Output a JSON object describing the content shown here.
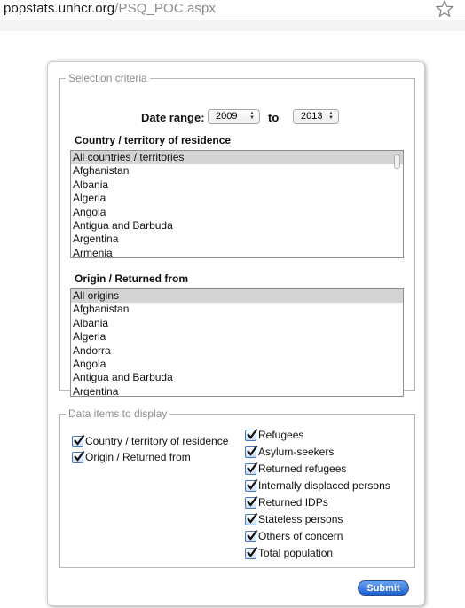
{
  "browser": {
    "url_host": "popstats.unhcr.org",
    "url_path": "/PSQ_POC.aspx"
  },
  "selection": {
    "legend": "Selection criteria",
    "date_range_label": "Date range:",
    "from_value": "2009",
    "to_label": "to",
    "to_value": "2013",
    "residence_title": "Country / territory of residence",
    "residence_items": [
      "All countries / territories",
      "Afghanistan",
      "Albania",
      "Algeria",
      "Angola",
      "Antigua and Barbuda",
      "Argentina",
      "Armenia"
    ],
    "origin_title": "Origin / Returned from",
    "origin_items": [
      "All origins",
      "Afghanistan",
      "Albania",
      "Algeria",
      "Andorra",
      "Angola",
      "Antigua and Barbuda",
      "Argentina"
    ]
  },
  "data_items": {
    "legend": "Data items to display",
    "left_column": [
      {
        "label": "Country / territory of residence",
        "checked": true
      },
      {
        "label": "Origin / Returned from",
        "checked": true
      }
    ],
    "right_column": [
      {
        "label": "Refugees",
        "checked": true
      },
      {
        "label": "Asylum-seekers",
        "checked": true
      },
      {
        "label": "Returned refugees",
        "checked": true
      },
      {
        "label": "Internally displaced persons",
        "checked": true
      },
      {
        "label": "Returned IDPs",
        "checked": true
      },
      {
        "label": "Stateless persons",
        "checked": true
      },
      {
        "label": "Others of concern",
        "checked": true
      },
      {
        "label": "Total population",
        "checked": true
      }
    ]
  },
  "submit_label": "Submit"
}
